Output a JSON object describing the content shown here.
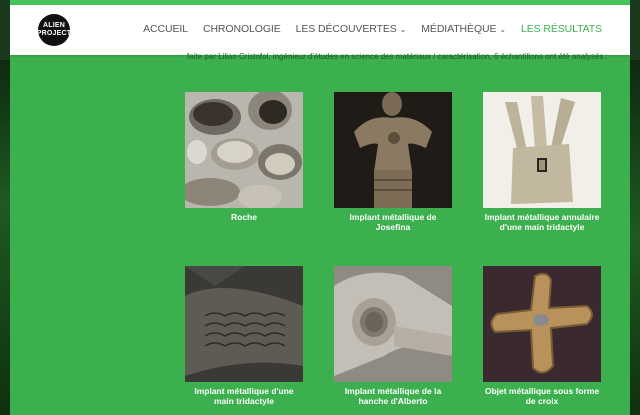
{
  "header": {
    "logo_lines": [
      "ALIEN",
      "PROJECT"
    ],
    "nav": [
      {
        "label": "ACCUEIL",
        "active": false,
        "dropdown": false
      },
      {
        "label": "CHRONOLOGIE",
        "active": false,
        "dropdown": false
      },
      {
        "label": "LES DÉCOUVERTES",
        "active": false,
        "dropdown": true
      },
      {
        "label": "MÉDIATHÈQUE",
        "active": false,
        "dropdown": true
      },
      {
        "label": "LES RÉSULTATS",
        "active": true,
        "dropdown": false
      }
    ]
  },
  "intro_text": "faite par Lilian Cristofol, ingénieur d'études en science des matériaux / caractérisation, 6 échantillons ont été analysés :",
  "items": [
    {
      "caption": "Roche",
      "image": "rock-photo"
    },
    {
      "caption": "Implant métallique de Josefina",
      "image": "figure-photo"
    },
    {
      "caption": "Implant métallique annulaire d'une main tridactyle",
      "image": "hand-photo"
    },
    {
      "caption": "Implant métallique d'une main tridactyle",
      "image": "scales-photo"
    },
    {
      "caption": "Implant métallique de la hanche d'Alberto",
      "image": "bone-photo"
    },
    {
      "caption": "Objet métallique sous forme de croix",
      "image": "cross-photo"
    }
  ],
  "colors": {
    "accent": "#3cb04e",
    "page_bg": "#3cb04e",
    "header_bg": "#ffffff",
    "nav_text": "#555555"
  }
}
